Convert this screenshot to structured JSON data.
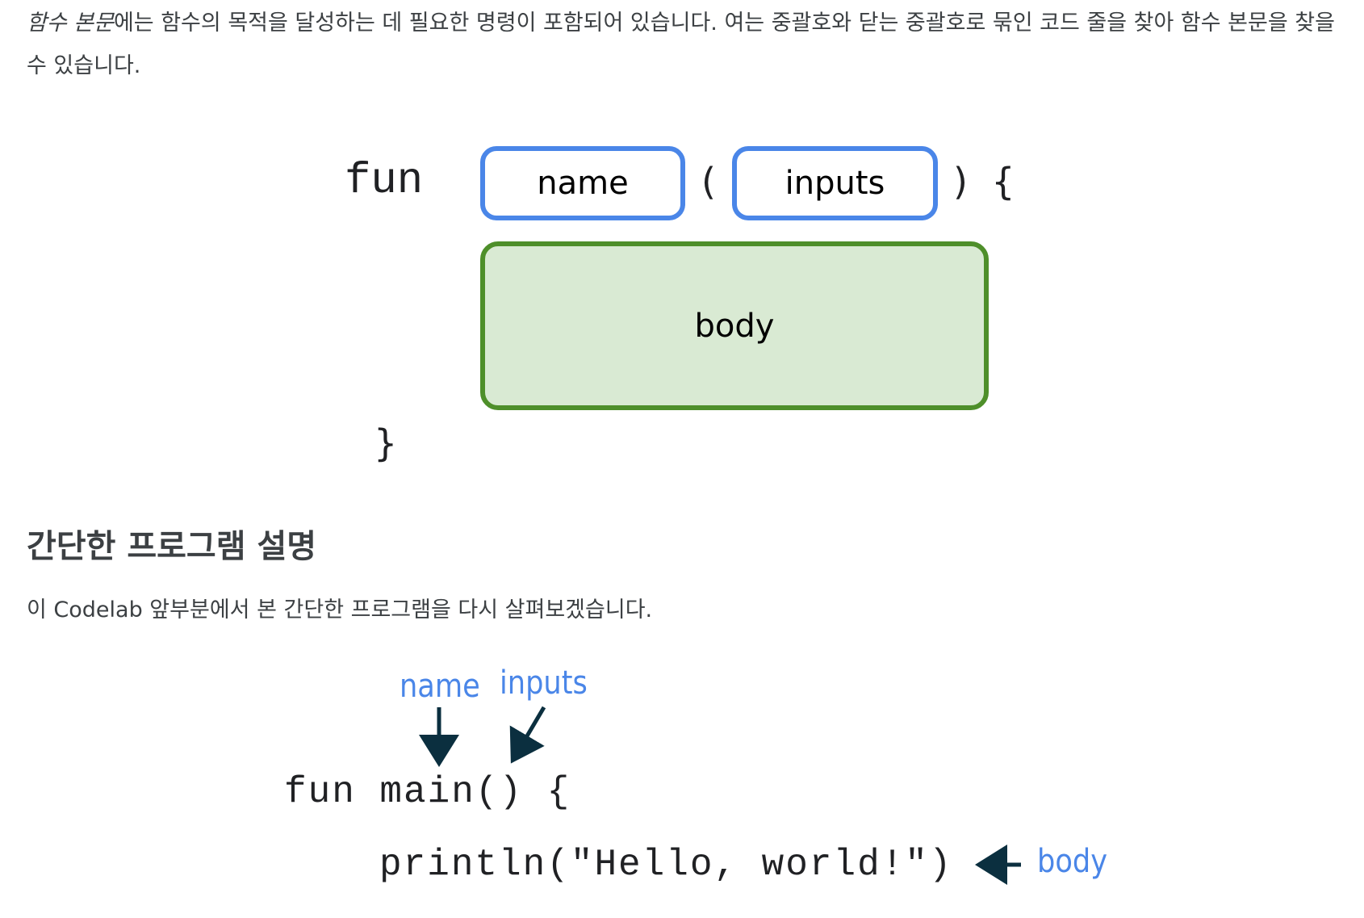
{
  "intro": {
    "term": "함수 본문",
    "text": "에는 함수의 목적을 달성하는 데 필요한 명령이 포함되어 있습니다. 여는 중괄호와 닫는 중괄호로 묶인 코드 줄을 찾아 함수 본문을 찾을 수 있습니다."
  },
  "diagram1": {
    "keyword": "fun",
    "name_box": "name",
    "open_paren": "(",
    "inputs_box": "inputs",
    "close_paren_brace": ")  {",
    "body_box": "body",
    "close_brace": "}"
  },
  "section": {
    "heading": "간단한 프로그램 설명",
    "text": "이 Codelab 앞부분에서 본 간단한 프로그램을 다시 살펴보겠습니다."
  },
  "diagram2": {
    "name_label": "name",
    "inputs_label": "inputs",
    "body_label": "body",
    "line1": "fun main() {",
    "line2": "println(\"Hello, world!\")"
  },
  "colors": {
    "blue": "#4a86e8",
    "green_border": "#4e8f2a",
    "green_fill": "#d9ead3",
    "arrow": "#0b2f3f"
  }
}
